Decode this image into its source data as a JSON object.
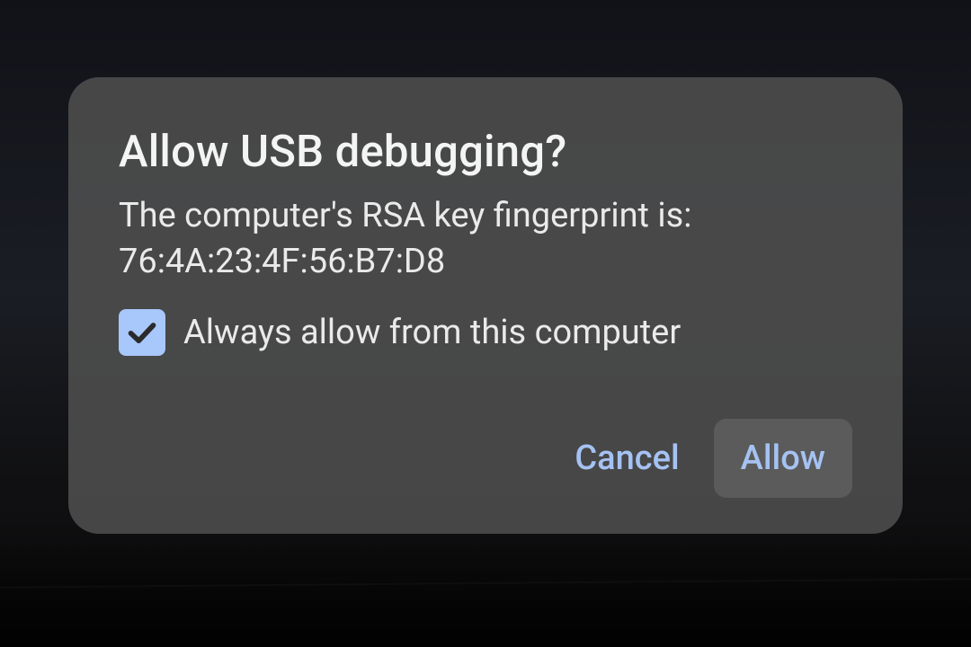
{
  "dialog": {
    "title": "Allow USB debugging?",
    "message_line1": "The computer's RSA key fingerprint is:",
    "message_line2": "76:4A:23:4F:56:B7:D8",
    "checkbox": {
      "label": "Always allow from this computer",
      "checked": true
    },
    "buttons": {
      "cancel": "Cancel",
      "allow": "Allow"
    }
  },
  "colors": {
    "accent": "#a5c2f2",
    "checkbox_bg": "#a8c7fa",
    "dialog_bg": "rgba(78,78,78,0.88)"
  }
}
